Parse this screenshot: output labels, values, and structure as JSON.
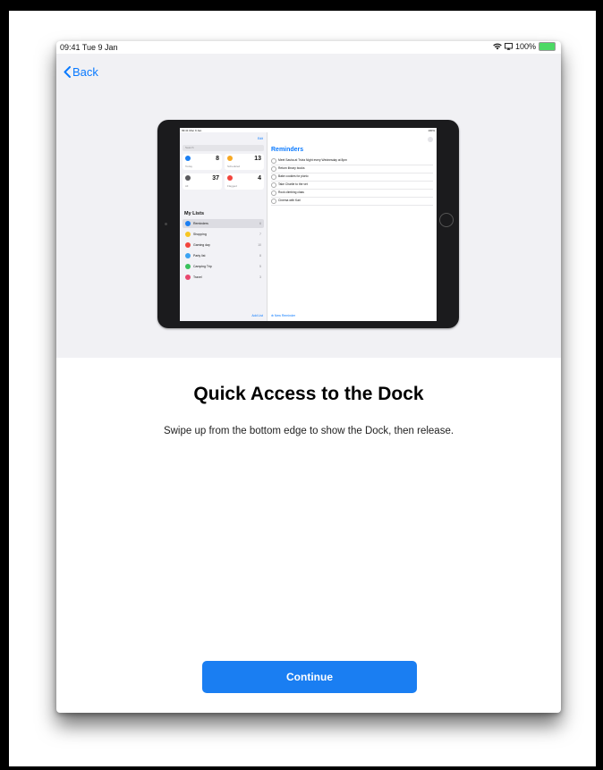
{
  "status_bar": {
    "time": "09:41",
    "date": "Tue 9 Jan",
    "battery": "100%"
  },
  "nav": {
    "back_label": "Back"
  },
  "illustration": {
    "status_left": "09:41 Mon 9 Jan",
    "status_right": "100%",
    "edit_label": "Edit",
    "search_placeholder": "Search",
    "smart_lists": [
      {
        "label": "Today",
        "count": "8",
        "color": "#1a7ef2"
      },
      {
        "label": "Scheduled",
        "count": "13",
        "color": "#f7a823"
      },
      {
        "label": "All",
        "count": "37",
        "color": "#5a5a5e"
      },
      {
        "label": "Flagged",
        "count": "4",
        "color": "#f2453d"
      }
    ],
    "my_lists_heading": "My Lists",
    "lists": [
      {
        "name": "Reminders",
        "count": "6",
        "color": "#1a7ef2"
      },
      {
        "name": "Shopping",
        "count": "7",
        "color": "#f7c623"
      },
      {
        "name": "Gaming day",
        "count": "10",
        "color": "#f2453d"
      },
      {
        "name": "Party list",
        "count": "8",
        "color": "#3ba2f2"
      },
      {
        "name": "Camping Trip",
        "count": "5",
        "color": "#39c15c"
      },
      {
        "name": "Travel",
        "count": "3",
        "color": "#e8476e"
      }
    ],
    "add_list_label": "Add List",
    "main_title": "Reminders",
    "reminders": [
      "Meet Sasha at Trivia Night every Wednesday at 8pm",
      "Return library books",
      "Bake cookies for picnic",
      "Take Charlie to the vet",
      "Rock climbing class",
      "Cinema with Kari"
    ],
    "new_reminder_label": "New Reminder"
  },
  "onboarding": {
    "title": "Quick Access to the Dock",
    "subtitle": "Swipe up from the bottom edge to show the Dock, then release.",
    "continue_label": "Continue"
  },
  "colors": {
    "accent": "#1a7ef2",
    "hero_bg": "#f1f1f4"
  }
}
